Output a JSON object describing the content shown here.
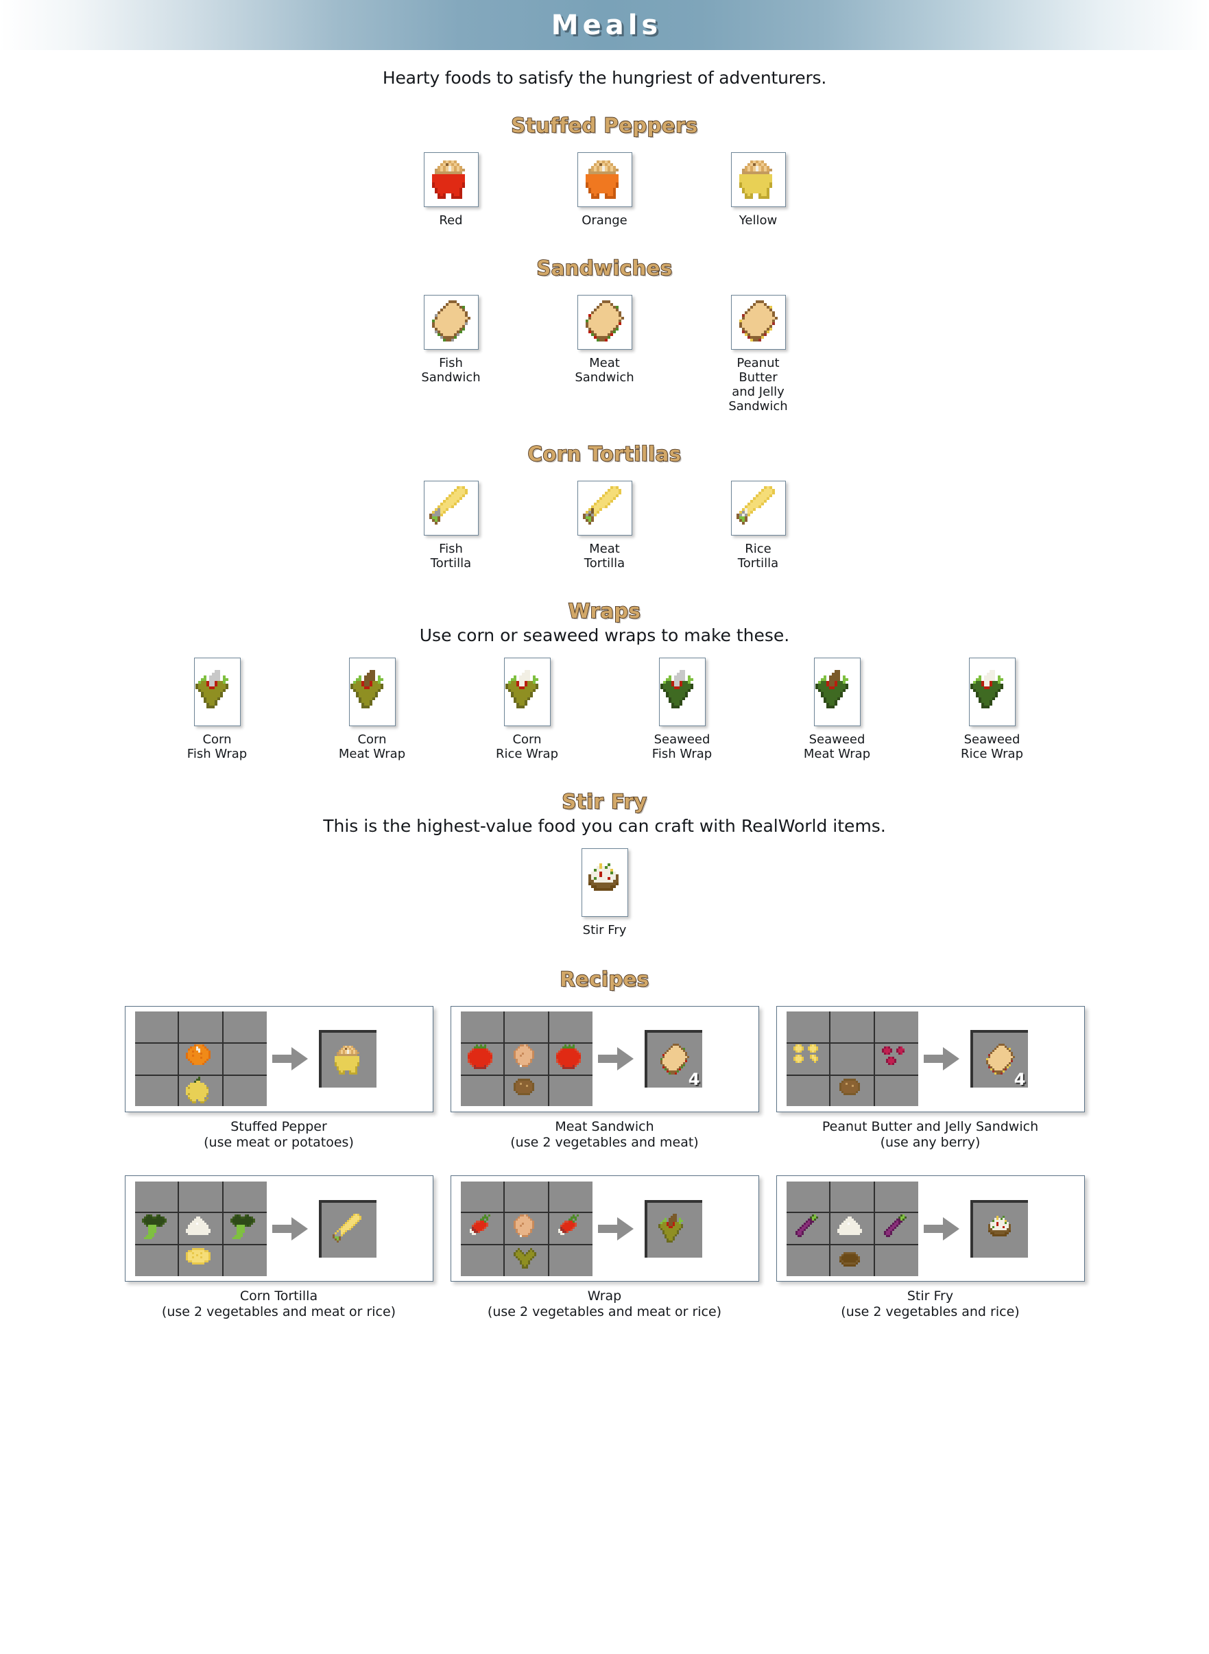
{
  "banner": {
    "title": "Meals"
  },
  "subtitle": "Hearty foods to satisfy the hungriest of adventurers.",
  "colors": {
    "heading_fill": "#d2a869",
    "heading_outline": "#3b2410",
    "banner_blue": "#7aa2b8",
    "slot_gray": "#8d8d8d",
    "grid_line": "#2f2f2f",
    "text": "#15181c",
    "box_border": "#6d8496"
  },
  "sections": [
    {
      "id": "stuffed-peppers",
      "heading": "Stuffed Peppers",
      "note": "",
      "box_style": "sq",
      "items": [
        {
          "label": "Red",
          "sprite": "stuffed-pepper-red"
        },
        {
          "label": "Orange",
          "sprite": "stuffed-pepper-orange"
        },
        {
          "label": "Yellow",
          "sprite": "stuffed-pepper-yellow"
        }
      ]
    },
    {
      "id": "sandwiches",
      "heading": "Sandwiches",
      "note": "",
      "box_style": "sq",
      "items": [
        {
          "label": "Fish\nSandwich",
          "sprite": "fish-sandwich"
        },
        {
          "label": "Meat\nSandwich",
          "sprite": "meat-sandwich"
        },
        {
          "label": "Peanut Butter\nand Jelly\nSandwich",
          "sprite": "pbj-sandwich"
        }
      ]
    },
    {
      "id": "corn-tortillas",
      "heading": "Corn Tortillas",
      "note": "",
      "box_style": "sq",
      "items": [
        {
          "label": "Fish\nTortilla",
          "sprite": "fish-tortilla"
        },
        {
          "label": "Meat\nTortilla",
          "sprite": "meat-tortilla"
        },
        {
          "label": "Rice\nTortilla",
          "sprite": "rice-tortilla"
        }
      ]
    },
    {
      "id": "wraps",
      "heading": "Wraps",
      "note": "Use corn or seaweed wraps to make these.",
      "box_style": "tall",
      "items": [
        {
          "label": "Corn\nFish Wrap",
          "sprite": "corn-fish-wrap"
        },
        {
          "label": "Corn\nMeat Wrap",
          "sprite": "corn-meat-wrap"
        },
        {
          "label": "Corn\nRice Wrap",
          "sprite": "corn-rice-wrap"
        },
        {
          "label": "Seaweed\nFish Wrap",
          "sprite": "seaweed-fish-wrap"
        },
        {
          "label": "Seaweed\nMeat Wrap",
          "sprite": "seaweed-meat-wrap"
        },
        {
          "label": "Seaweed\nRice Wrap",
          "sprite": "seaweed-rice-wrap"
        }
      ]
    },
    {
      "id": "stir-fry",
      "heading": "Stir Fry",
      "note": "This is the highest-value food you can craft with RealWorld items.",
      "box_style": "stir",
      "items": [
        {
          "label": "Stir Fry",
          "sprite": "stir-fry"
        }
      ]
    }
  ],
  "recipes_heading": "Recipes",
  "recipes": [
    {
      "id": "recipe-stuffed-pepper",
      "label": "Stuffed Pepper\n(use meat or potatoes)",
      "cells": [
        "",
        "",
        "",
        "",
        "cooked-potato",
        "",
        "",
        "yellow-pepper",
        ""
      ],
      "result": {
        "sprite": "stuffed-pepper-yellow",
        "count": ""
      }
    },
    {
      "id": "recipe-meat-sandwich",
      "label": "Meat Sandwich\n(use 2 vegetables and meat)",
      "cells": [
        "",
        "",
        "",
        "tomato",
        "cooked-meat",
        "tomato",
        "",
        "bread",
        ""
      ],
      "result": {
        "sprite": "meat-sandwich",
        "count": "4"
      }
    },
    {
      "id": "recipe-pbj-sandwich",
      "label": "Peanut Butter and Jelly Sandwich\n(use any berry)",
      "cells": [
        "",
        "",
        "",
        "peanuts",
        "",
        "berries",
        "",
        "bread",
        ""
      ],
      "result": {
        "sprite": "pbj-sandwich",
        "count": "4"
      }
    },
    {
      "id": "recipe-corn-tortilla",
      "label": "Corn Tortilla\n(use 2 vegetables and meat or rice)",
      "cells": [
        "",
        "",
        "",
        "broccoli",
        "rice",
        "broccoli",
        "",
        "corn-tortilla-shell",
        ""
      ],
      "result": {
        "sprite": "fish-tortilla",
        "count": ""
      }
    },
    {
      "id": "recipe-wrap",
      "label": "Wrap\n(use 2 vegetables and meat or rice)",
      "cells": [
        "",
        "",
        "",
        "radish",
        "cooked-meat",
        "radish",
        "",
        "corn-husk",
        ""
      ],
      "result": {
        "sprite": "corn-meat-wrap",
        "count": ""
      }
    },
    {
      "id": "recipe-stir-fry",
      "label": "Stir Fry\n(use 2 vegetables and rice)",
      "cells": [
        "",
        "",
        "",
        "eggplant",
        "rice",
        "eggplant",
        "",
        "bowl",
        ""
      ],
      "result": {
        "sprite": "stir-fry",
        "count": ""
      }
    }
  ]
}
